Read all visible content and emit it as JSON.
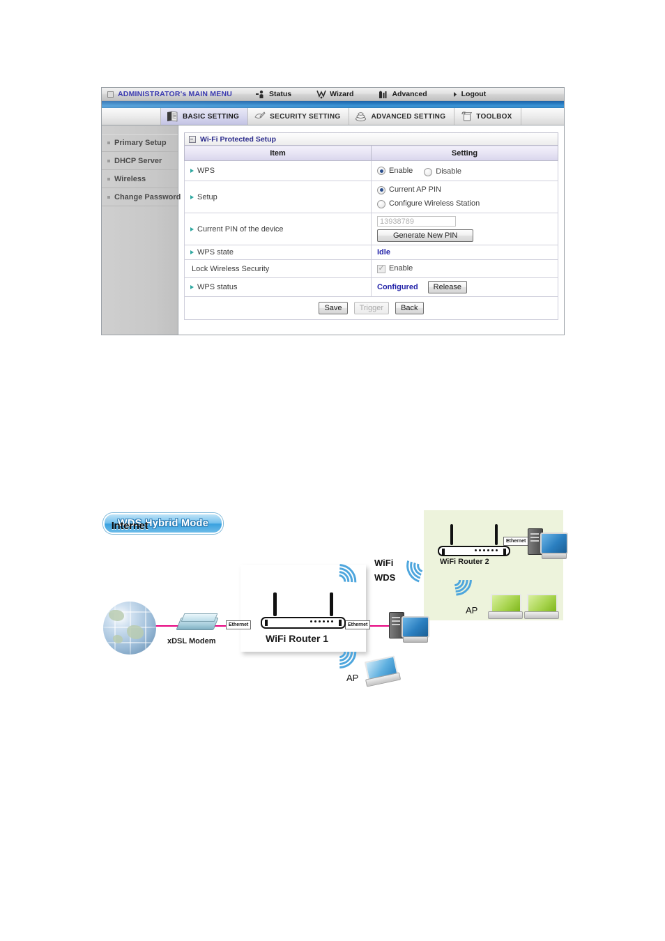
{
  "admin": {
    "menu": {
      "title": "ADMINISTRATOR's MAIN MENU",
      "items": [
        {
          "label": "Status",
          "icon": "status-icon"
        },
        {
          "label": "Wizard",
          "icon": "wizard-icon"
        },
        {
          "label": "Advanced",
          "icon": "advanced-icon"
        },
        {
          "label": "Logout",
          "icon": "arrow-right-icon"
        }
      ]
    },
    "tabs": [
      {
        "label": "BASIC SETTING",
        "icon": "book-icon",
        "active": true
      },
      {
        "label": "SECURITY SETTING",
        "icon": "shield-pen-icon",
        "active": false
      },
      {
        "label": "ADVANCED SETTING",
        "icon": "stack-icon",
        "active": false
      },
      {
        "label": "TOOLBOX",
        "icon": "toolbox-icon",
        "active": false
      }
    ],
    "sidebar": {
      "items": [
        {
          "label": "Primary Setup"
        },
        {
          "label": "DHCP Server"
        },
        {
          "label": "Wireless"
        },
        {
          "label": "Change Password"
        }
      ]
    },
    "panel": {
      "title": "Wi-Fi Protected Setup",
      "columns": {
        "item": "Item",
        "setting": "Setting"
      },
      "rows": {
        "wps": {
          "label": "WPS",
          "enable_label": "Enable",
          "disable_label": "Disable",
          "selected": "Enable"
        },
        "setup": {
          "label": "Setup",
          "option_current_ap_pin": "Current AP PIN",
          "option_configure_station": "Configure Wireless Station",
          "selected": "Current AP PIN"
        },
        "pin": {
          "label": "Current PIN of the device",
          "value": "13938789",
          "generate_button": "Generate New PIN"
        },
        "wps_state": {
          "label": "WPS state",
          "value": "Idle"
        },
        "lock": {
          "label": "Lock Wireless Security",
          "enable_label": "Enable",
          "checked": true
        },
        "wps_status": {
          "label": "WPS status",
          "value": "Configured",
          "release_button": "Release"
        }
      },
      "footer": {
        "save": "Save",
        "trigger": "Trigger",
        "back": "Back"
      }
    },
    "colors": {
      "menu_title": "#3a3ab0",
      "panel_title": "#2b2b8c",
      "status_value": "#2222a8",
      "band_blue": "#2a7fc4",
      "arrow_teal": "#2fa8a0"
    }
  },
  "diagram": {
    "badge": "WDS Hybrid Mode",
    "internet_label": "Internet",
    "modem_label": "xDSL Modem",
    "ethernet_label": "Ethernet",
    "router1_label": "WiFi Router 1",
    "router2_label": "WiFi Router 2",
    "wifi_label": "WiFi",
    "wds_label": "WDS",
    "ap_label_left": "AP",
    "ap_label_right": "AP",
    "colors": {
      "link": "#e6007e",
      "panel_green": "#edf3dc",
      "wifi_arc": "#4ea6dd"
    }
  }
}
